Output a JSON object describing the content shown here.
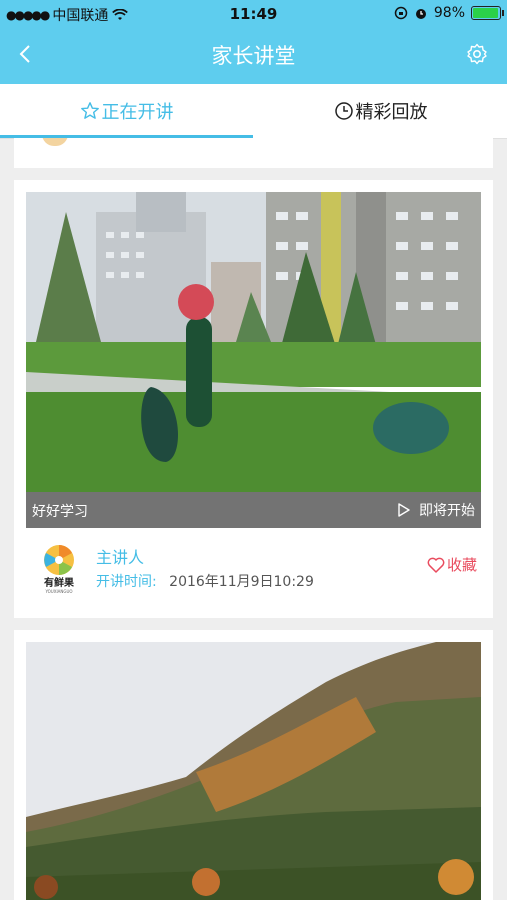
{
  "status_bar": {
    "carrier": "中国联通",
    "time": "11:49",
    "battery_percent": "98%",
    "battery_level": 0.98
  },
  "navbar": {
    "title": "家长讲堂",
    "back_icon": "chevron-left-icon",
    "settings_icon": "gear-icon"
  },
  "tabs": [
    {
      "label": "正在开讲",
      "icon": "star-outline-icon",
      "active": true
    },
    {
      "label": "精彩回放",
      "icon": "clock-icon",
      "active": false
    }
  ],
  "lectures": [
    {
      "title": "好好学习",
      "status": "即将开始",
      "speaker": "主讲人",
      "time_label": "开讲时间:",
      "time_value": "2016年11月9日10:29",
      "favorite_label": "收藏",
      "logo_text": "有鲜果",
      "logo_subtext": "YOUXIANGUO"
    }
  ],
  "colors": {
    "accent": "#5ecdee",
    "tab_active": "#45bde6",
    "favorite": "#e94b5e",
    "background": "#eeeeee"
  }
}
